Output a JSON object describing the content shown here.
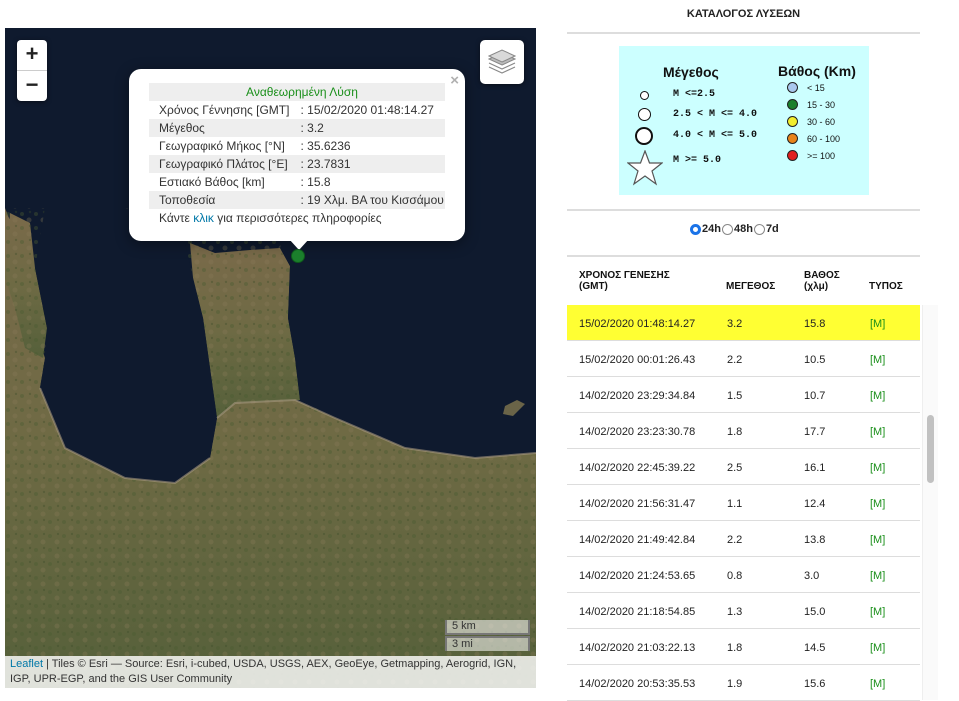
{
  "map": {
    "zoom_in": "+",
    "zoom_out": "−",
    "layers_icon": "layers-icon",
    "popup": {
      "close": "×",
      "title": "Αναθεωρημένη Λύση",
      "rows": [
        {
          "label": "Χρόνος Γέννησης [GMT]",
          "value": ": 15/02/2020 01:48:14.27"
        },
        {
          "label": "Μέγεθος",
          "value": ": 3.2"
        },
        {
          "label": "Γεωγραφικό Μήκος [°N]",
          "value": ": 35.6236"
        },
        {
          "label": "Γεωγραφικό Πλάτος [°E]",
          "value": ": 23.7831"
        },
        {
          "label": "Εστιακό Βάθος [km]",
          "value": ": 15.8"
        },
        {
          "label": "Τοποθεσία",
          "value": ": 19 Χλμ. ΒΑ του Κισσάμου"
        }
      ],
      "more_prefix": "Κάντε ",
      "more_link": "κλικ",
      "more_suffix": " για περισσότερες πληροφορίες"
    },
    "scale_km": "5 km",
    "scale_mi": "3 mi",
    "attribution_link": "Leaflet",
    "attribution_text": " | Tiles © Esri — Source: Esri, i-cubed, USDA, USGS, AEX, GeoEye, Getmapping, Aerogrid, IGN, IGP, UPR-EGP, and the GIS User Community"
  },
  "panel": {
    "title": "ΚΑΤΑΛΟΓΟΣ ΛΥΣΕΩΝ",
    "legend": {
      "magnitude_title": "Μέγεθος",
      "depth_title": "Βάθος (Km)",
      "magnitudes": [
        "M <=2.5",
        "2.5 < M <= 4.0",
        "4.0 < M <= 5.0",
        "M >= 5.0"
      ],
      "depths": [
        {
          "label": "< 15",
          "color": "#a9c8ee"
        },
        {
          "label": "15 - 30",
          "color": "#1b7f2c"
        },
        {
          "label": "30 - 60",
          "color": "#f2ee2e"
        },
        {
          "label": "60 - 100",
          "color": "#e8841a"
        },
        {
          "label": ">= 100",
          "color": "#e01e1e"
        }
      ]
    },
    "ranges": [
      {
        "label": "24h",
        "selected": true
      },
      {
        "label": "48h",
        "selected": false
      },
      {
        "label": "7d",
        "selected": false
      }
    ],
    "headers": {
      "time": "ΧΡΟΝΟΣ ΓΕΝΕΣΗΣ (GMT)",
      "magnitude": "ΜΕΓΕΘΟΣ",
      "depth": "ΒΑΘΟΣ (χλμ)",
      "type": "ΤΥΠΟΣ"
    },
    "rows": [
      {
        "time": "15/02/2020 01:48:14.27",
        "mag": "3.2",
        "depth": "15.8",
        "type": "[M]"
      },
      {
        "time": "15/02/2020 00:01:26.43",
        "mag": "2.2",
        "depth": "10.5",
        "type": "[M]"
      },
      {
        "time": "14/02/2020 23:29:34.84",
        "mag": "1.5",
        "depth": "10.7",
        "type": "[M]"
      },
      {
        "time": "14/02/2020 23:23:30.78",
        "mag": "1.8",
        "depth": "17.7",
        "type": "[M]"
      },
      {
        "time": "14/02/2020 22:45:39.22",
        "mag": "2.5",
        "depth": "16.1",
        "type": "[M]"
      },
      {
        "time": "14/02/2020 21:56:31.47",
        "mag": "1.1",
        "depth": "12.4",
        "type": "[M]"
      },
      {
        "time": "14/02/2020 21:49:42.84",
        "mag": "2.2",
        "depth": "13.8",
        "type": "[M]"
      },
      {
        "time": "14/02/2020 21:24:53.65",
        "mag": "0.8",
        "depth": "3.0",
        "type": "[M]"
      },
      {
        "time": "14/02/2020 21:18:54.85",
        "mag": "1.3",
        "depth": "15.0",
        "type": "[M]"
      },
      {
        "time": "14/02/2020 21:03:22.13",
        "mag": "1.8",
        "depth": "14.5",
        "type": "[M]"
      },
      {
        "time": "14/02/2020 20:53:35.53",
        "mag": "1.9",
        "depth": "15.6",
        "type": "[M]"
      }
    ],
    "highlight_color": "#ffff33"
  }
}
